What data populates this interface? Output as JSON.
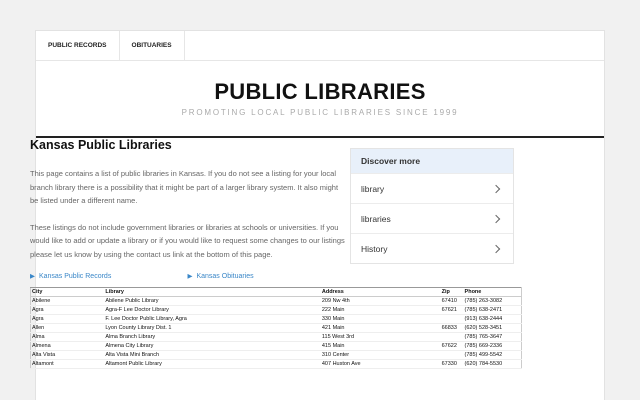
{
  "nav": {
    "items": [
      "PUBLIC RECORDS",
      "OBITUARIES"
    ]
  },
  "header": {
    "title": "PUBLIC LIBRARIES",
    "tagline": "PROMOTING LOCAL PUBLIC LIBRARIES SINCE 1999"
  },
  "main": {
    "title": "Kansas Public Libraries",
    "para1": "This page contains a list of public libraries in Kansas. If you do not see a listing for your local branch library there is a possibility that it might be part of a larger library system. It also might be listed under a different name.",
    "para2": "These listings do not include government libraries or libraries at schools or universities. If you would like to add or update a library or if you would like to request some changes to our listings please let us know by using the contact us link at the bottom of this page.",
    "link1": "Kansas Public Records",
    "link2": "Kansas Obituaries",
    "arrow": "▶"
  },
  "sidebar": {
    "heading": "Discover more",
    "items": [
      "library",
      "libraries",
      "History"
    ]
  },
  "table": {
    "headers": [
      "City",
      "Library",
      "Address",
      "Zip",
      "Phone"
    ],
    "rows": [
      [
        "Abilene",
        "Abilene Public Library",
        "209 Nw 4th",
        "67410",
        "(785) 263-3082"
      ],
      [
        "Agra",
        "Agra-F Lee Doctor Library",
        "222 Main",
        "67621",
        "(785) 638-2471"
      ],
      [
        "Agra",
        "F. Lee Doctor Public Library, Agra",
        "330 Main",
        "",
        "(913) 638-2444"
      ],
      [
        "Allen",
        "Lyon County Library Dist. 1",
        "421 Main",
        "66833",
        "(620) 528-3451"
      ],
      [
        "Alma",
        "Alma Branch Library",
        "115 West 3rd",
        "",
        "(785) 765-3647"
      ],
      [
        "Almena",
        "Almena City Library",
        "415 Main",
        "67622",
        "(785) 669-2336"
      ],
      [
        "Alta Vista",
        "Alta Vista Mini Branch",
        "310 Center",
        "",
        "(785) 499-5542"
      ],
      [
        "Altamont",
        "Altamont Public Library",
        "407 Huston Ave",
        "67330",
        "(620) 784-5530"
      ]
    ]
  }
}
